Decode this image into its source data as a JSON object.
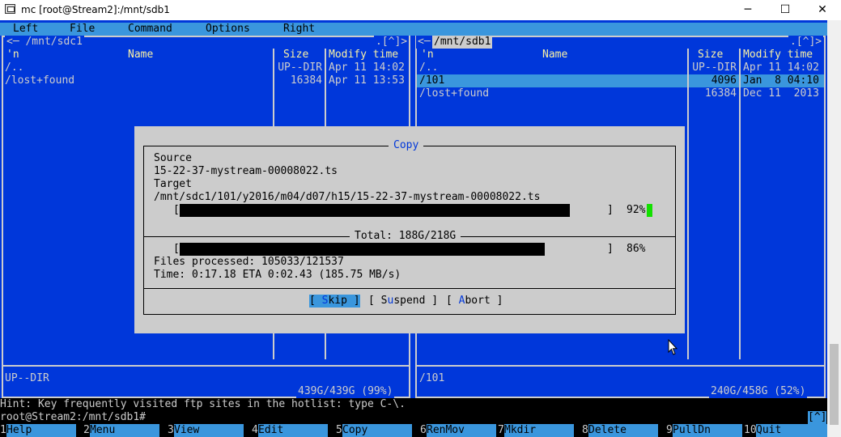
{
  "window": {
    "title": "mc [root@Stream2]:/mnt/sdb1",
    "minimize_glyph": "─",
    "maximize_glyph": "☐",
    "close_glyph": "✕"
  },
  "menubar": [
    "Left",
    "File",
    "Command",
    "Options",
    "Right"
  ],
  "left_panel": {
    "path_title": "<─ /mnt/sdc1",
    "title_right": ".[^]>",
    "columns": {
      "name_marker": "'n",
      "name": "Name",
      "size": "Size",
      "modify": "Modify time"
    },
    "rows": [
      {
        "name": "/..",
        "size": "UP--DIR",
        "modify": "Apr 11 14:02"
      },
      {
        "name": "/lost+found",
        "size": "16384",
        "modify": "Apr 11 13:53"
      }
    ],
    "status_text": "UP--DIR",
    "disk_usage": "439G/439G (99%)"
  },
  "right_panel": {
    "path_title_left": "<─",
    "path_title": "/mnt/sdb1",
    "title_right": ".[^]>",
    "columns": {
      "name_marker": "'n",
      "name": "Name",
      "size": "Size",
      "modify": "Modify time"
    },
    "rows": [
      {
        "name": "/..",
        "size": "UP--DIR",
        "modify": "Apr 11 14:02"
      },
      {
        "name": "/101",
        "size": "4096",
        "modify": "Jan  8 04:10",
        "selected": true
      },
      {
        "name": "/lost+found",
        "size": "16384",
        "modify": "Dec 11  2013"
      }
    ],
    "status_text": "/101",
    "disk_usage": "240G/458G (52%)"
  },
  "copy_dialog": {
    "title": "Copy",
    "source_label": "Source",
    "source_value": "15-22-37-mystream-00008022.ts",
    "target_label": "Target",
    "target_value": "/mnt/sdc1/101/y2016/m04/d07/h15/15-22-37-mystream-00008022.ts",
    "file_progress": {
      "open": "[",
      "close": "]",
      "percent_text": "92%",
      "fraction": 0.92
    },
    "total_label": "Total: 188G/218G",
    "total_progress": {
      "open": "[",
      "close": "]",
      "percent_text": "86%",
      "fraction": 0.86
    },
    "files_processed": "Files processed: 105033/121537",
    "time_line": "Time: 0:17.18 ETA 0:02.43 (185.75 MB/s)",
    "buttons": {
      "skip_pre": "[ ",
      "skip_hot": "S",
      "skip_rest": "kip ]",
      "suspend_pre": "[ ",
      "suspend_a": "S",
      "suspend_hot": "u",
      "suspend_rest": "spend ]",
      "abort_pre": "[ ",
      "abort_hot": "A",
      "abort_rest": "bort ]"
    }
  },
  "hint": "Hint: Key frequently visited ftp sites in the hotlist: type C-\\.",
  "command_line": "root@Stream2:/mnt/sdb1#",
  "command_corner": "[^]",
  "function_keys": [
    {
      "num": "1",
      "label": "Help"
    },
    {
      "num": "2",
      "label": "Menu"
    },
    {
      "num": "3",
      "label": "View"
    },
    {
      "num": "4",
      "label": "Edit"
    },
    {
      "num": "5",
      "label": "Copy"
    },
    {
      "num": "6",
      "label": "RenMov"
    },
    {
      "num": "7",
      "label": "Mkdir"
    },
    {
      "num": "8",
      "label": "Delete"
    },
    {
      "num": "9",
      "label": "PullDn"
    },
    {
      "num": "10",
      "label": "Quit"
    }
  ],
  "colors": {
    "background": "#0037da",
    "panel_text": "#cccccc",
    "header": "#f9f1a5",
    "highlight": "#3a96dd",
    "dialog": "#cccccc"
  }
}
